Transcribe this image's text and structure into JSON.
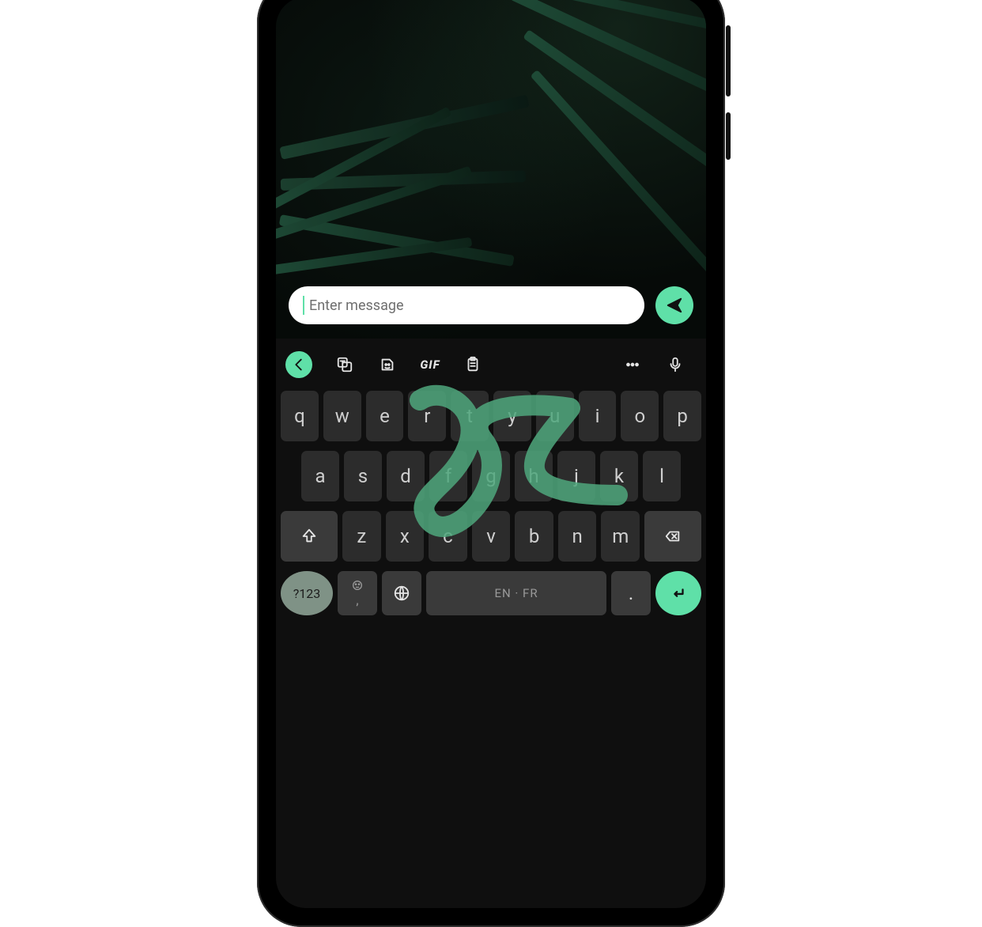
{
  "compose": {
    "placeholder": "Enter message",
    "send_icon": "send-icon"
  },
  "suggestion_bar": {
    "back_icon": "chevron-left-icon",
    "items": [
      "translate-icon",
      "sticker-icon",
      "gif-label",
      "clipboard-icon"
    ],
    "gif_label": "GIF",
    "more_icon": "more-icon",
    "mic_icon": "mic-icon"
  },
  "keyboard": {
    "row1": [
      "q",
      "w",
      "e",
      "r",
      "t",
      "y",
      "u",
      "i",
      "o",
      "p"
    ],
    "row2": [
      "a",
      "s",
      "d",
      "f",
      "g",
      "h",
      "j",
      "k",
      "l"
    ],
    "row3": [
      "z",
      "x",
      "c",
      "v",
      "b",
      "n",
      "m"
    ],
    "shift_icon": "shift-icon",
    "backspace_icon": "backspace-icon",
    "numbers_label": "?123",
    "emoji_icon": "emoji-icon",
    "comma": ",",
    "globe_icon": "globe-icon",
    "space_label": "EN · FR",
    "period": ".",
    "enter_icon": "enter-icon"
  },
  "colors": {
    "accent": "#5fe0a8"
  }
}
